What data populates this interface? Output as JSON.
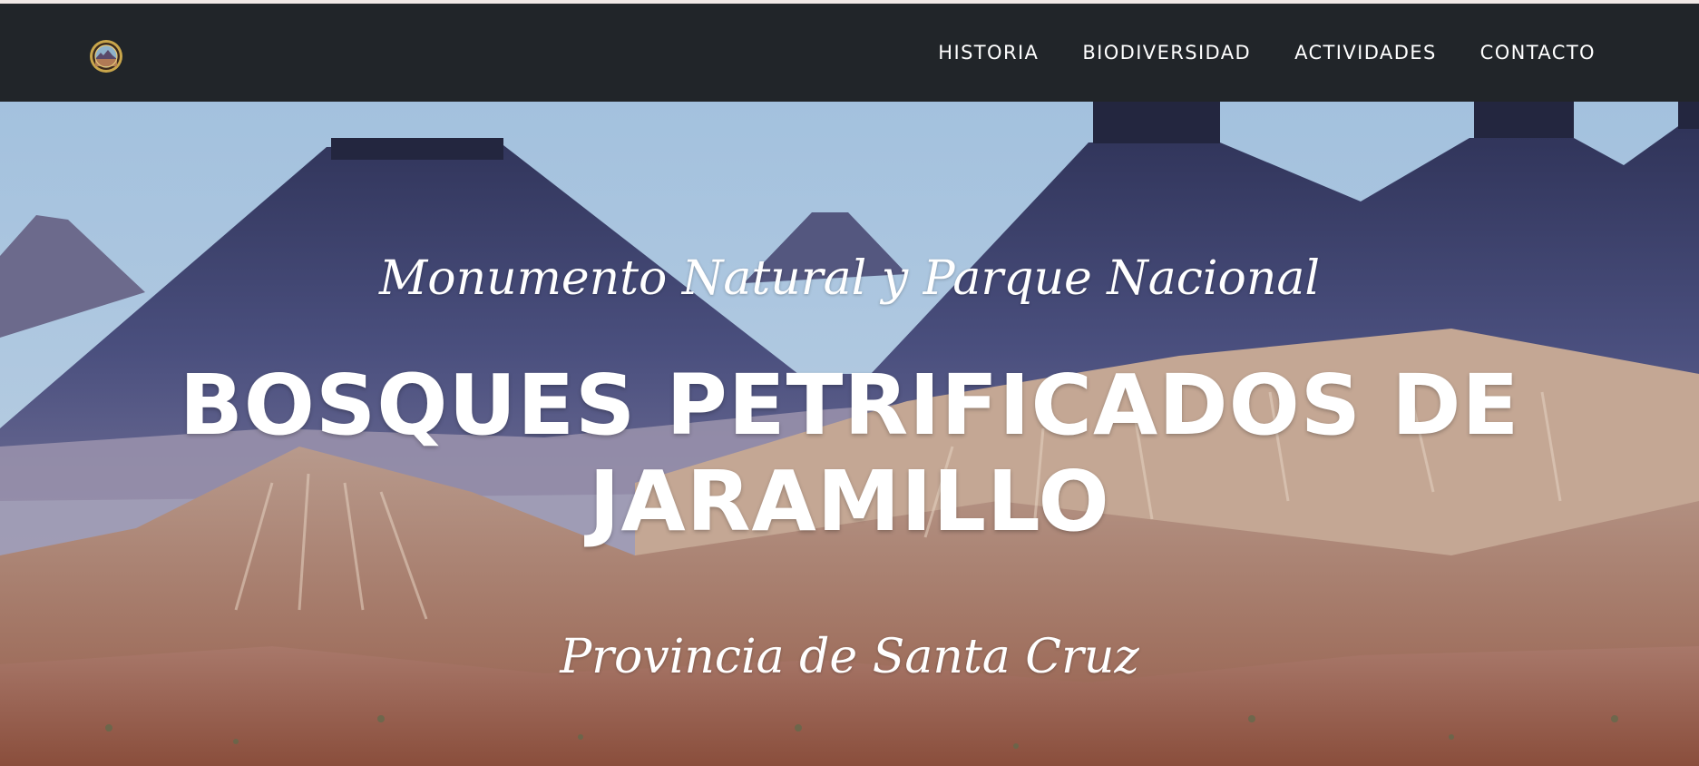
{
  "navbar": {
    "logo_icon": "park-emblem-icon",
    "links": [
      {
        "label": "HISTORIA"
      },
      {
        "label": "BIODIVERSIDAD"
      },
      {
        "label": "ACTIVIDADES"
      },
      {
        "label": "CONTACTO"
      }
    ]
  },
  "hero": {
    "subheading": "Monumento Natural y Parque Nacional",
    "heading": "BOSQUES PETRIFICADOS DE JARAMILLO",
    "province": "Provincia de Santa Cruz",
    "background": "mesa-landscape-photo"
  },
  "colors": {
    "navbar_bg": "#212529",
    "top_strip": "#f1e9e6",
    "text": "#ffffff",
    "sky": "#a7c3de",
    "mountain": "#3f4570"
  }
}
